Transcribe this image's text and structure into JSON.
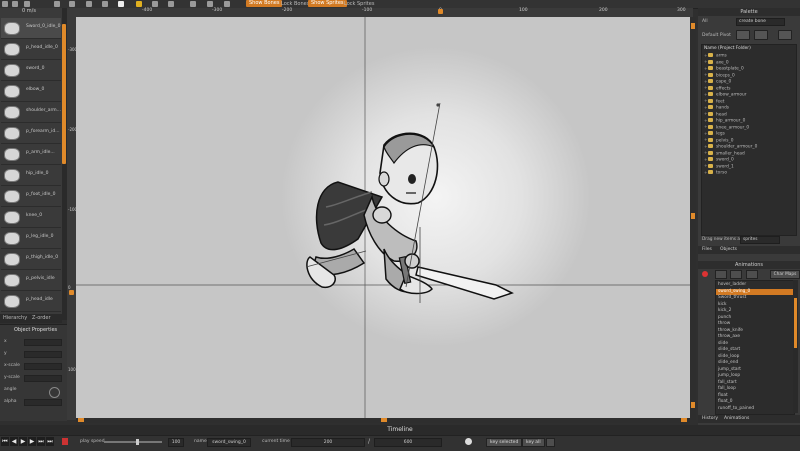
{
  "toolbar": {
    "show_bones": "Show Bones",
    "lock_bones": "Lock Bones",
    "show_sprites": "Show Sprites",
    "lock_sprites": "Lock Sprites"
  },
  "palette": {
    "header": "0 m/s",
    "items": [
      {
        "label": "Sword_0_idle_0"
      },
      {
        "label": "p_head_idle_0"
      },
      {
        "label": "sword_0"
      },
      {
        "label": "elbow_0"
      },
      {
        "label": "shoulder_arm..."
      },
      {
        "label": "p_forearm_id..."
      },
      {
        "label": "p_arm_idle..."
      },
      {
        "label": "hip_idle_0"
      },
      {
        "label": "p_foot_idle_0"
      },
      {
        "label": "knee_0"
      },
      {
        "label": "p_leg_idle_0"
      },
      {
        "label": "p_thigh_idle_0"
      },
      {
        "label": "p_pelvis_idle"
      },
      {
        "label": "p_head_idle"
      }
    ],
    "tabs": {
      "left": "Hierarchy",
      "right": "Z-order"
    }
  },
  "object_properties": {
    "title": "Object Properties",
    "rows": [
      "x",
      "y",
      "x-scale",
      "y-scale",
      "angle",
      "alpha"
    ]
  },
  "ruler": {
    "top_ticks": [
      "-400",
      "-300",
      "-200",
      "-100",
      "0",
      "100",
      "200",
      "300",
      "400"
    ],
    "left_ticks": [
      "-300",
      "-200",
      "-100",
      "0",
      "100"
    ]
  },
  "right_panel": {
    "palette_title": "Palette",
    "palette_scale_label": "All",
    "palette_create_button": "create bone",
    "default_pivot_label": "Default Pivot",
    "tree_header": "Name   (Project Folder)",
    "folders": [
      "arms",
      "axe_0",
      "beastplate_0",
      "biceps_0",
      "cape_0",
      "effects",
      "elbow_armour",
      "feet",
      "hands",
      "head",
      "hip_armour_0",
      "knee_armour_0",
      "legs",
      "pelvis_0",
      "shoulder_armour_0",
      "smaller_head",
      "sword_0",
      "sword_1",
      "torso"
    ],
    "drag_hint": "Drag new items as",
    "drag_value": "sprites",
    "tabs": [
      "Files",
      "Objects"
    ],
    "animations_title": "Animations",
    "char_maps_button": "Char Maps",
    "animations": [
      "hover_ladder",
      "sword_swing_0",
      "Sword_thrust",
      "kick",
      "kick_2",
      "punch",
      "throw",
      "throw_knife",
      "throw_axe",
      "slide",
      "slide_start",
      "slide_loop",
      "slide_end",
      "jump_start",
      "jump_loop",
      "fall_start",
      "fall_loop",
      "float",
      "float_0",
      "runoff_to_pained"
    ],
    "selected_animation": "sword_swing_0",
    "bottom_tabs": [
      "History",
      "Animations"
    ]
  },
  "timeline": {
    "title": "Timeline",
    "play_speed_label": "play speed",
    "play_speed_value": "100",
    "name_label": "name",
    "name_value": "sword_swing_0",
    "current_time_label": "current time",
    "current_time_value": "200",
    "separator": "/",
    "length_value": "600",
    "key_selected_button": "key selected",
    "key_all_button": "key all"
  },
  "colors": {
    "accent": "#d27a23",
    "canvas": "#c6c6c6"
  }
}
